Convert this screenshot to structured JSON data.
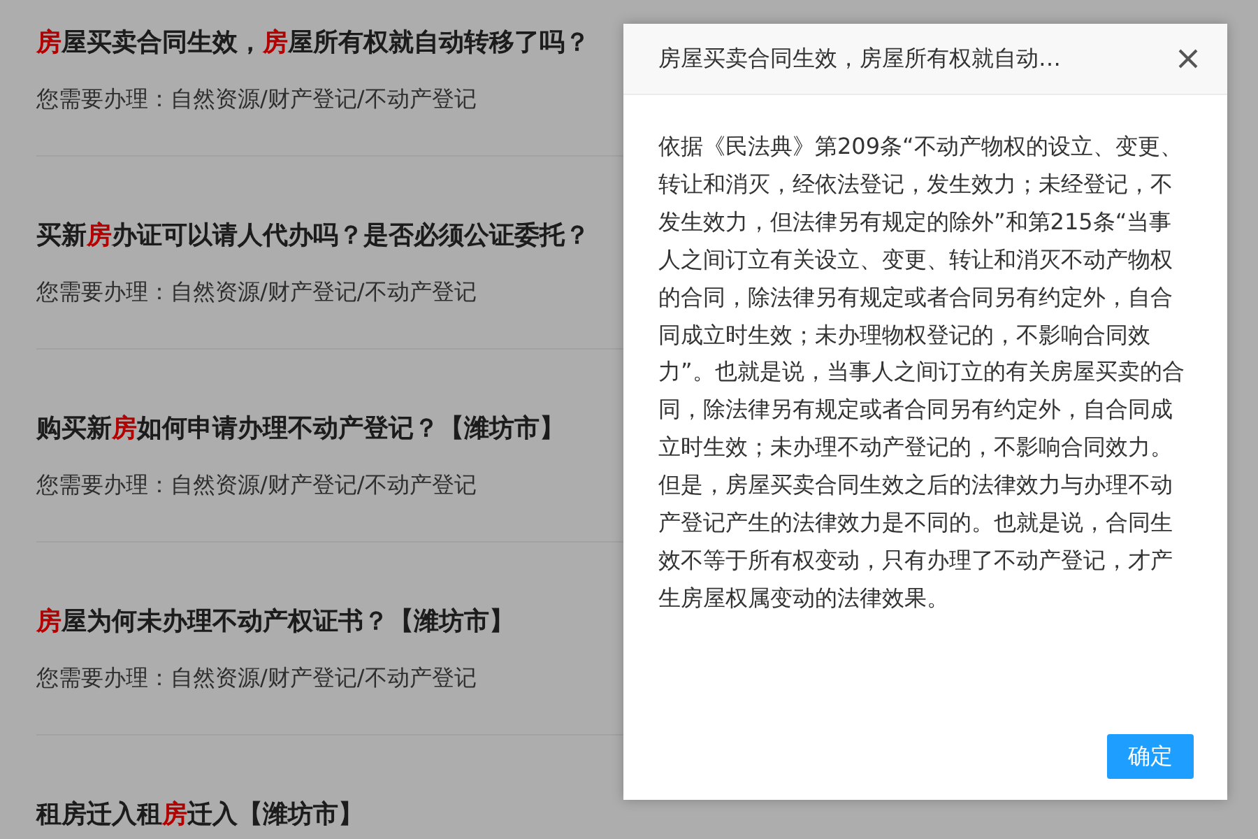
{
  "items": [
    {
      "title": [
        {
          "text": "房",
          "highlight": true
        },
        {
          "text": "屋买卖合同生效，",
          "highlight": false
        },
        {
          "text": "房",
          "highlight": true
        },
        {
          "text": "屋所有权就自动转移了吗？",
          "highlight": false
        }
      ],
      "subtitle": "您需要办理：自然资源/财产登记/不动产登记"
    },
    {
      "title": [
        {
          "text": "买新",
          "highlight": false
        },
        {
          "text": "房",
          "highlight": true
        },
        {
          "text": "办证可以请人代办吗？是否必须公证委托？",
          "highlight": false
        }
      ],
      "subtitle": "您需要办理：自然资源/财产登记/不动产登记"
    },
    {
      "title": [
        {
          "text": "购买新",
          "highlight": false
        },
        {
          "text": "房",
          "highlight": true
        },
        {
          "text": "如何申请办理不动产登记？【潍坊市】",
          "highlight": false
        }
      ],
      "subtitle": "您需要办理：自然资源/财产登记/不动产登记"
    },
    {
      "title": [
        {
          "text": "房",
          "highlight": true
        },
        {
          "text": "屋为何未办理不动产权证书？【潍坊市】",
          "highlight": false
        }
      ],
      "subtitle": "您需要办理：自然资源/财产登记/不动产登记"
    },
    {
      "title": [
        {
          "text": "租房迁入租",
          "highlight": false
        },
        {
          "text": "房",
          "highlight": true
        },
        {
          "text": "迁入【潍坊市】",
          "highlight": false
        }
      ]
    }
  ],
  "dialog": {
    "title": "房屋买卖合同生效，房屋所有权就自动…",
    "body": "依据《民法典》第209条“不动产物权的设立、变更、转让和消灭，经依法登记，发生效力；未经登记，不发生效力，但法律另有规定的除外”和第215条“当事人之间订立有关设立、变更、转让和消灭不动产物权的合同，除法律另有规定或者合同另有约定外，自合同成立时生效；未办理物权登记的，不影响合同效力”。也就是说，当事人之间订立的有关房屋买卖的合同，除法律另有规定或者合同另有约定外，自合同成立时生效；未办理不动产登记的，不影响合同效力。但是，房屋买卖合同生效之后的法律效力与办理不动产登记产生的法律效力是不同的。也就是说，合同生效不等于所有权变动，只有办理了不动产登记，才产生房屋权属变动的法律效果。",
    "button": "确定"
  }
}
